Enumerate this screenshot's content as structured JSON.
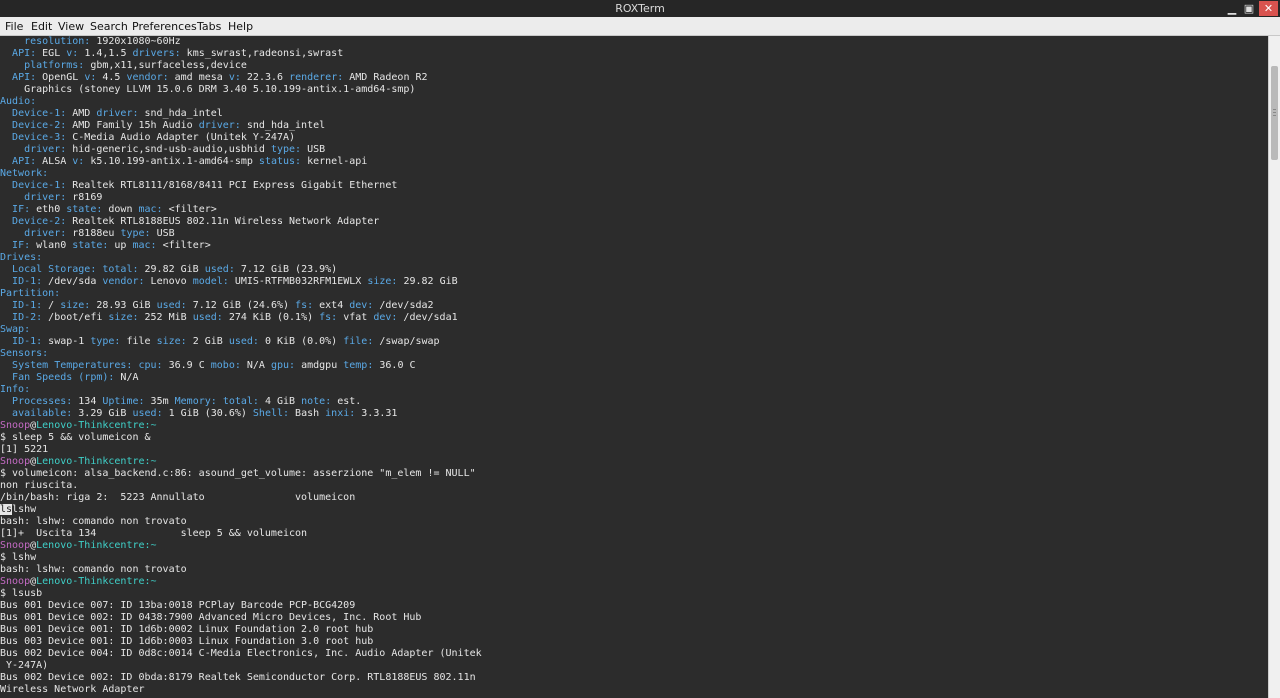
{
  "window": {
    "title": "ROXTerm",
    "min_glyph": "▁",
    "max_glyph": "▣",
    "close_glyph": "✕"
  },
  "menu": [
    "File",
    "Edit",
    "View",
    "Search",
    "Preferences",
    "Tabs",
    "Help"
  ],
  "prompt": {
    "user": "Snoop",
    "at": "@",
    "host": "Lenovo-Thinkcentre",
    "path": ":~",
    "dollar": "$ "
  },
  "lines": [
    [
      [
        "    ",
        ""
      ],
      [
        "resolution:",
        "k"
      ],
      [
        " 1920x1080~60Hz",
        ""
      ]
    ],
    [
      [
        "  ",
        ""
      ],
      [
        "API:",
        "k"
      ],
      [
        " EGL ",
        ""
      ],
      [
        "v:",
        "k"
      ],
      [
        " 1.4,1.5 ",
        ""
      ],
      [
        "drivers:",
        "k"
      ],
      [
        " kms_swrast,radeonsi,swrast",
        ""
      ]
    ],
    [
      [
        "    ",
        ""
      ],
      [
        "platforms:",
        "k"
      ],
      [
        " gbm,x11,surfaceless,device",
        ""
      ]
    ],
    [
      [
        "  ",
        ""
      ],
      [
        "API:",
        "k"
      ],
      [
        " OpenGL ",
        ""
      ],
      [
        "v:",
        "k"
      ],
      [
        " 4.5 ",
        ""
      ],
      [
        "vendor:",
        "k"
      ],
      [
        " amd mesa ",
        ""
      ],
      [
        "v:",
        "k"
      ],
      [
        " 22.3.6 ",
        ""
      ],
      [
        "renderer:",
        "k"
      ],
      [
        " AMD Radeon R2",
        ""
      ]
    ],
    [
      [
        "    Graphics (stoney LLVM 15.0.6 DRM 3.40 5.10.199-antix.1-amd64-smp)",
        ""
      ]
    ],
    [
      [
        "Audio:",
        "k"
      ]
    ],
    [
      [
        "  ",
        ""
      ],
      [
        "Device-1:",
        "k"
      ],
      [
        " AMD ",
        ""
      ],
      [
        "driver:",
        "k"
      ],
      [
        " snd_hda_intel",
        ""
      ]
    ],
    [
      [
        "  ",
        ""
      ],
      [
        "Device-2:",
        "k"
      ],
      [
        " AMD Family 15h Audio ",
        ""
      ],
      [
        "driver:",
        "k"
      ],
      [
        " snd_hda_intel",
        ""
      ]
    ],
    [
      [
        "  ",
        ""
      ],
      [
        "Device-3:",
        "k"
      ],
      [
        " C-Media Audio Adapter (Unitek Y-247A)",
        ""
      ]
    ],
    [
      [
        "    ",
        ""
      ],
      [
        "driver:",
        "k"
      ],
      [
        " hid-generic,snd-usb-audio,usbhid ",
        ""
      ],
      [
        "type:",
        "k"
      ],
      [
        " USB",
        ""
      ]
    ],
    [
      [
        "  ",
        ""
      ],
      [
        "API:",
        "k"
      ],
      [
        " ALSA ",
        ""
      ],
      [
        "v:",
        "k"
      ],
      [
        " k5.10.199-antix.1-amd64-smp ",
        ""
      ],
      [
        "status:",
        "k"
      ],
      [
        " kernel-api",
        ""
      ]
    ],
    [
      [
        "Network:",
        "k"
      ]
    ],
    [
      [
        "  ",
        ""
      ],
      [
        "Device-1:",
        "k"
      ],
      [
        " Realtek RTL8111/8168/8411 PCI Express Gigabit Ethernet",
        ""
      ]
    ],
    [
      [
        "    ",
        ""
      ],
      [
        "driver:",
        "k"
      ],
      [
        " r8169",
        ""
      ]
    ],
    [
      [
        "  ",
        ""
      ],
      [
        "IF:",
        "k"
      ],
      [
        " eth0 ",
        ""
      ],
      [
        "state:",
        "k"
      ],
      [
        " down ",
        ""
      ],
      [
        "mac:",
        "k"
      ],
      [
        " <filter>",
        ""
      ]
    ],
    [
      [
        "  ",
        ""
      ],
      [
        "Device-2:",
        "k"
      ],
      [
        " Realtek RTL8188EUS 802.11n Wireless Network Adapter",
        ""
      ]
    ],
    [
      [
        "    ",
        ""
      ],
      [
        "driver:",
        "k"
      ],
      [
        " r8188eu ",
        ""
      ],
      [
        "type:",
        "k"
      ],
      [
        " USB",
        ""
      ]
    ],
    [
      [
        "  ",
        ""
      ],
      [
        "IF:",
        "k"
      ],
      [
        " wlan0 ",
        ""
      ],
      [
        "state:",
        "k"
      ],
      [
        " up ",
        ""
      ],
      [
        "mac:",
        "k"
      ],
      [
        " <filter>",
        ""
      ]
    ],
    [
      [
        "Drives:",
        "k"
      ]
    ],
    [
      [
        "  ",
        ""
      ],
      [
        "Local Storage:",
        "k"
      ],
      [
        " ",
        ""
      ],
      [
        "total:",
        "k"
      ],
      [
        " 29.82 GiB ",
        ""
      ],
      [
        "used:",
        "k"
      ],
      [
        " 7.12 GiB (23.9%)",
        ""
      ]
    ],
    [
      [
        "  ",
        ""
      ],
      [
        "ID-1:",
        "k"
      ],
      [
        " /dev/sda ",
        ""
      ],
      [
        "vendor:",
        "k"
      ],
      [
        " Lenovo ",
        ""
      ],
      [
        "model:",
        "k"
      ],
      [
        " UMIS-RTFMB032RFM1EWLX ",
        ""
      ],
      [
        "size:",
        "k"
      ],
      [
        " 29.82 GiB",
        ""
      ]
    ],
    [
      [
        "Partition:",
        "k"
      ]
    ],
    [
      [
        "  ",
        ""
      ],
      [
        "ID-1:",
        "k"
      ],
      [
        " / ",
        ""
      ],
      [
        "size:",
        "k"
      ],
      [
        " 28.93 GiB ",
        ""
      ],
      [
        "used:",
        "k"
      ],
      [
        " 7.12 GiB (24.6%) ",
        ""
      ],
      [
        "fs:",
        "k"
      ],
      [
        " ext4 ",
        ""
      ],
      [
        "dev:",
        "k"
      ],
      [
        " /dev/sda2",
        ""
      ]
    ],
    [
      [
        "  ",
        ""
      ],
      [
        "ID-2:",
        "k"
      ],
      [
        " /boot/efi ",
        ""
      ],
      [
        "size:",
        "k"
      ],
      [
        " 252 MiB ",
        ""
      ],
      [
        "used:",
        "k"
      ],
      [
        " 274 KiB (0.1%) ",
        ""
      ],
      [
        "fs:",
        "k"
      ],
      [
        " vfat ",
        ""
      ],
      [
        "dev:",
        "k"
      ],
      [
        " /dev/sda1",
        ""
      ]
    ],
    [
      [
        "Swap:",
        "k"
      ]
    ],
    [
      [
        "  ",
        ""
      ],
      [
        "ID-1:",
        "k"
      ],
      [
        " swap-1 ",
        ""
      ],
      [
        "type:",
        "k"
      ],
      [
        " file ",
        ""
      ],
      [
        "size:",
        "k"
      ],
      [
        " 2 GiB ",
        ""
      ],
      [
        "used:",
        "k"
      ],
      [
        " 0 KiB (0.0%) ",
        ""
      ],
      [
        "file:",
        "k"
      ],
      [
        " /swap/swap",
        ""
      ]
    ],
    [
      [
        "Sensors:",
        "k"
      ]
    ],
    [
      [
        "  ",
        ""
      ],
      [
        "System Temperatures:",
        "k"
      ],
      [
        " ",
        ""
      ],
      [
        "cpu:",
        "k"
      ],
      [
        " 36.9 C ",
        ""
      ],
      [
        "mobo:",
        "k"
      ],
      [
        " N/A ",
        ""
      ],
      [
        "gpu:",
        "k"
      ],
      [
        " amdgpu ",
        ""
      ],
      [
        "temp:",
        "k"
      ],
      [
        " 36.0 C",
        ""
      ]
    ],
    [
      [
        "  ",
        ""
      ],
      [
        "Fan Speeds (rpm):",
        "k"
      ],
      [
        " N/A",
        ""
      ]
    ],
    [
      [
        "Info:",
        "k"
      ]
    ],
    [
      [
        "  ",
        ""
      ],
      [
        "Processes:",
        "k"
      ],
      [
        " 134 ",
        ""
      ],
      [
        "Uptime:",
        "k"
      ],
      [
        " 35m ",
        ""
      ],
      [
        "Memory:",
        "k"
      ],
      [
        " ",
        ""
      ],
      [
        "total:",
        "k"
      ],
      [
        " 4 GiB ",
        ""
      ],
      [
        "note:",
        "k"
      ],
      [
        " est.",
        ""
      ]
    ],
    [
      [
        "  ",
        ""
      ],
      [
        "available:",
        "k"
      ],
      [
        " 3.29 GiB ",
        ""
      ],
      [
        "used:",
        "k"
      ],
      [
        " 1 GiB (30.6%) ",
        ""
      ],
      [
        "Shell:",
        "k"
      ],
      [
        " Bash ",
        ""
      ],
      [
        "inxi:",
        "k"
      ],
      [
        " 3.3.31",
        ""
      ]
    ],
    "PROMPT",
    [
      [
        "$ sleep 5 && volumeicon &",
        ""
      ]
    ],
    [
      [
        "[1] 5221",
        ""
      ]
    ],
    "PROMPT",
    [
      [
        "$ volumeicon: alsa_backend.c:86: asound_get_volume: asserzione \"m_elem != NULL\"",
        ""
      ]
    ],
    [
      [
        "non riuscita.",
        ""
      ]
    ],
    [
      [
        "/bin/bash: riga 2:  5223 Annullato               volumeicon",
        ""
      ]
    ],
    [
      [
        "ls",
        "cursor"
      ],
      [
        "lshw",
        ""
      ]
    ],
    [
      [
        "bash: lshw: comando non trovato",
        ""
      ]
    ],
    [
      [
        "[1]+  Uscita 134              sleep 5 && volumeicon",
        ""
      ]
    ],
    "PROMPT",
    [
      [
        "$ lshw",
        ""
      ]
    ],
    [
      [
        "bash: lshw: comando non trovato",
        ""
      ]
    ],
    "PROMPT",
    [
      [
        "$ lsusb",
        ""
      ]
    ],
    [
      [
        "Bus 001 Device 007: ID 13ba:0018 PCPlay Barcode PCP-BCG4209",
        ""
      ]
    ],
    [
      [
        "Bus 001 Device 002: ID 0438:7900 Advanced Micro Devices, Inc. Root Hub",
        ""
      ]
    ],
    [
      [
        "Bus 001 Device 001: ID 1d6b:0002 Linux Foundation 2.0 root hub",
        ""
      ]
    ],
    [
      [
        "Bus 003 Device 001: ID 1d6b:0003 Linux Foundation 3.0 root hub",
        ""
      ]
    ],
    [
      [
        "Bus 002 Device 004: ID 0d8c:0014 C-Media Electronics, Inc. Audio Adapter (Unitek",
        ""
      ]
    ],
    [
      [
        " Y-247A)",
        ""
      ]
    ],
    [
      [
        "Bus 002 Device 002: ID 0bda:8179 Realtek Semiconductor Corp. RTL8188EUS 802.11n",
        ""
      ]
    ],
    [
      [
        "Wireless Network Adapter",
        ""
      ]
    ]
  ]
}
